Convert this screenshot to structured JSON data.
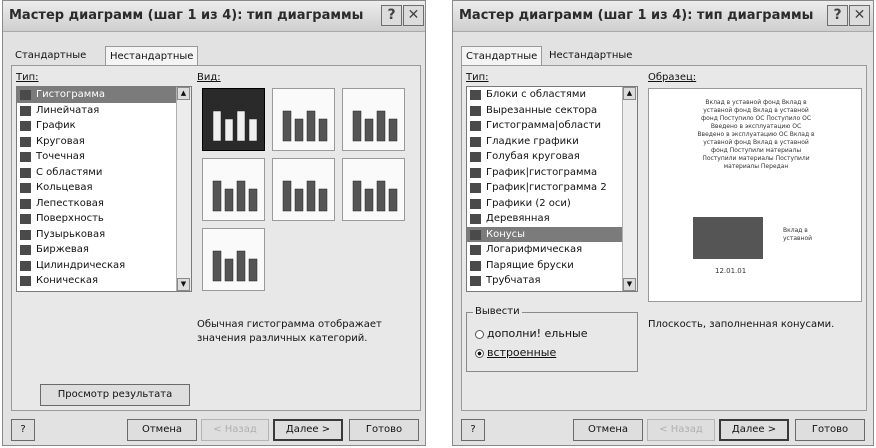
{
  "left": {
    "title": "Мастер диаграмм (шаг 1 из 4): тип диаграммы",
    "tabs": [
      "Стандартные",
      "Нестандартные"
    ],
    "type_label": "Тип:",
    "view_label": "Вид:",
    "types": [
      "Гистограмма",
      "Линейчатая",
      "График",
      "Круговая",
      "Точечная",
      "С областями",
      "Кольцевая",
      "Лепестковая",
      "Поверхность",
      "Пузырьковая",
      "Биржевая",
      "Цилиндрическая",
      "Коническая"
    ],
    "selected_type": "Гистограмма",
    "description": [
      "Обычная гистограмма отображает",
      "значения различных категорий."
    ],
    "preview_button": "Просмотр результата",
    "buttons": {
      "cancel": "Отмена",
      "back": "< Назад",
      "next": "Далее >",
      "finish": "Готово"
    }
  },
  "right": {
    "title": "Мастер диаграмм (шаг 1 из 4): тип диаграммы",
    "tabs": [
      "Стандартные",
      "Нестандартные"
    ],
    "type_label": "Тип:",
    "sample_label": "Образец:",
    "types": [
      "Блоки с областями",
      "Вырезанные сектора",
      "Гистограмма|области",
      "Гладкие графики",
      "Голубая круговая",
      "График|гистограмма",
      "График|гистограмма 2",
      "Графики (2 оси)",
      "Деревянная",
      "Конусы",
      "Логарифмическая",
      "Парящие бруски",
      "Трубчатая"
    ],
    "selected_type": "Конусы",
    "sample_text": [
      "Вклад в уставной фонд Вклад в",
      "уставной фонд Вклад в уставной",
      "фонд Поступило ОС Поступило ОС",
      "Введено в эксплуатацию ОС",
      "Введено в эксплуатацию ОС Вклад в",
      "уставной фонд Вклад в уставной",
      "фонд Поступили материалы",
      "Поступили материалы Поступили",
      "материалы Передан"
    ],
    "sample_legend": [
      "Вклад в",
      "уставной"
    ],
    "sample_date": "12.01.01",
    "output_label": "Вывести",
    "output_options": [
      "дополни! ельные",
      "встроенные"
    ],
    "description": "Плоскость, заполненная конусами.",
    "buttons": {
      "cancel": "Отмена",
      "back": "< Назад",
      "next": "Далее >",
      "finish": "Готово"
    }
  }
}
